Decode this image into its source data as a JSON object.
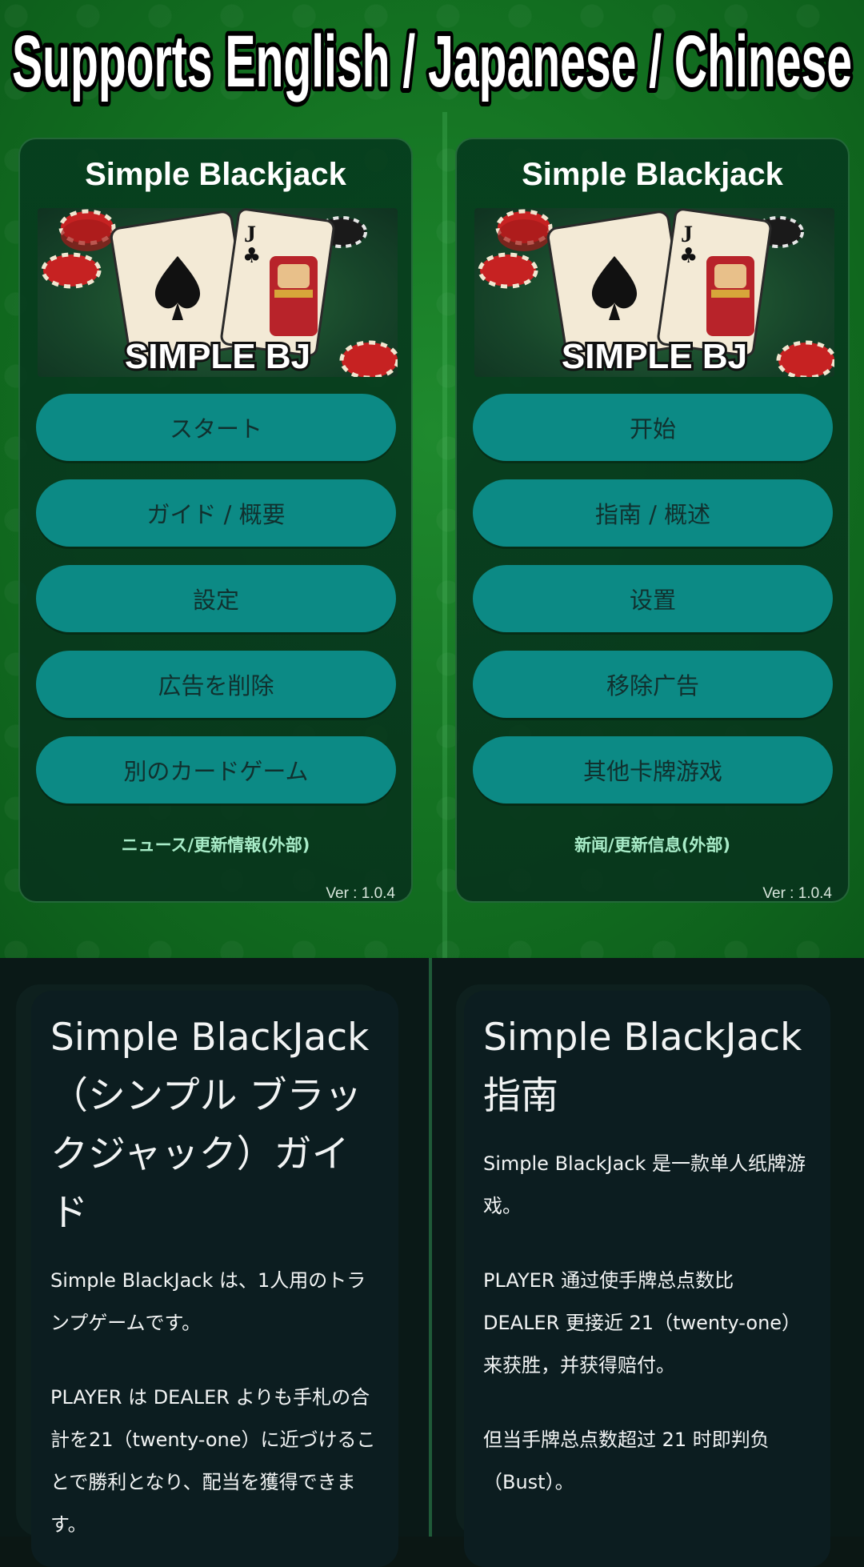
{
  "headline": "Supports  English / Japanese / Chinese",
  "left_screen": {
    "app_title": "Simple Blackjack",
    "logo_text": "SIMPLE BJ",
    "buttons": [
      "スタート",
      "ガイド / 概要",
      "設定",
      "広告を削除",
      "別のカードゲーム"
    ],
    "news_link": "ニュース/更新情報(外部)",
    "version": "Ver : 1.0.4"
  },
  "right_screen": {
    "app_title": "Simple Blackjack",
    "logo_text": "SIMPLE BJ",
    "buttons": [
      "开始",
      "指南 / 概述",
      "设置",
      "移除广告",
      "其他卡牌游戏"
    ],
    "news_link": "新闻/更新信息(外部)",
    "version": "Ver : 1.0.4"
  },
  "guide_ja": {
    "title": "Simple BlackJack（シンプル ブラックジャック）ガイド",
    "paragraphs": [
      "Simple BlackJack は、1人用のトランプゲームです。",
      "PLAYER は DEALER よりも手札の合計を21（twenty-one）に近づけることで勝利となり、配当を獲得できます。"
    ]
  },
  "guide_zh": {
    "title": "Simple BlackJack 指南",
    "paragraphs": [
      "Simple BlackJack 是一款单人纸牌游戏。",
      "PLAYER 通过使手牌总点数比 DEALER 更接近 21（twenty-one）来获胜，并获得赔付。",
      "但当手牌总点数超过 21 时即判负（Bust）。"
    ]
  },
  "colors": {
    "felt_green": "#137021",
    "button_teal": "#0c8a85",
    "button_text": "#11302e",
    "news_link": "#a8ecc8",
    "guide_bg": "#0c1d20"
  },
  "icons": [
    "spade-card",
    "jack-of-clubs-card",
    "poker-chip"
  ]
}
